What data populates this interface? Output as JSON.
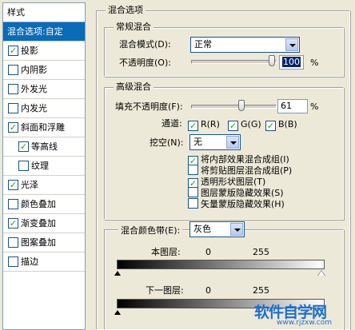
{
  "sidebar": {
    "header": "样式",
    "items": [
      {
        "label": "混合选项:自定",
        "checkbox": false,
        "checked": false,
        "active": true
      },
      {
        "label": "投影",
        "checkbox": true,
        "checked": true
      },
      {
        "label": "内阴影",
        "checkbox": true,
        "checked": false
      },
      {
        "label": "外发光",
        "checkbox": true,
        "checked": false
      },
      {
        "label": "内发光",
        "checkbox": true,
        "checked": false
      },
      {
        "label": "斜面和浮雕",
        "checkbox": true,
        "checked": true
      },
      {
        "label": "等高线",
        "checkbox": true,
        "checked": true,
        "sub": true
      },
      {
        "label": "纹理",
        "checkbox": true,
        "checked": false,
        "sub": true
      },
      {
        "label": "光泽",
        "checkbox": true,
        "checked": true
      },
      {
        "label": "颜色叠加",
        "checkbox": true,
        "checked": false
      },
      {
        "label": "渐变叠加",
        "checkbox": true,
        "checked": true
      },
      {
        "label": "图案叠加",
        "checkbox": true,
        "checked": false
      },
      {
        "label": "描边",
        "checkbox": true,
        "checked": false
      }
    ]
  },
  "blend_options": {
    "title": "混合选项",
    "general": {
      "title": "常规混合",
      "blend_mode_label": "混合模式(D):",
      "blend_mode_value": "正常",
      "opacity_label": "不透明度(O):",
      "opacity_value": "100",
      "opacity_unit": "%",
      "opacity_level": 100
    },
    "advanced": {
      "title": "高级混合",
      "fill_opacity_label": "填充不透明度(F):",
      "fill_opacity_value": "61",
      "fill_opacity_unit": "%",
      "fill_opacity_level": 61,
      "channels_label": "通道:",
      "channels": [
        {
          "label": "R(R)",
          "checked": true
        },
        {
          "label": "G(G)",
          "checked": true
        },
        {
          "label": "B(B)",
          "checked": true
        }
      ],
      "knockout_label": "挖空(N):",
      "knockout_value": "无",
      "options": [
        {
          "label": "将内部效果混合成组(I)",
          "checked": true
        },
        {
          "label": "将剪贴图层混合成组(P)",
          "checked": false
        },
        {
          "label": "透明形状图层(T)",
          "checked": true
        },
        {
          "label": "图层蒙版隐藏效果(S)",
          "checked": false
        },
        {
          "label": "矢量蒙版隐藏效果(H)",
          "checked": false
        }
      ]
    },
    "blend_if": {
      "label": "混合颜色带(E):",
      "value": "灰色",
      "this_layer_label": "本图层:",
      "this_layer_min": "0",
      "this_layer_max": "255",
      "underlying_label": "下一图层:",
      "underlying_min": "0",
      "underlying_max": "255"
    }
  },
  "watermark": {
    "text": "软件自学网",
    "url": "www.rjzxw.com"
  }
}
